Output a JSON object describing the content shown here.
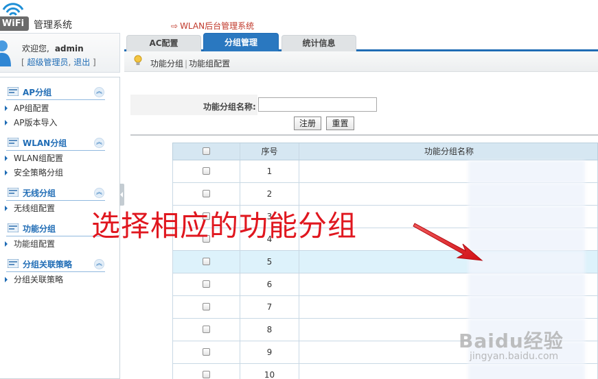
{
  "header": {
    "logo_text": "WiFi",
    "system_title": "管理系统",
    "top_link": "WLAN后台管理系统"
  },
  "user": {
    "welcome": "欢迎您,",
    "username": "admin",
    "role": "超级管理员",
    "logout": "退出",
    "bracket_open": "[",
    "bracket_sep": ",",
    "bracket_close": "]"
  },
  "sidebar": {
    "groups": [
      {
        "title": "AP分组",
        "items": [
          "AP组配置",
          "AP版本导入"
        ]
      },
      {
        "title": "WLAN分组",
        "items": [
          "WLAN组配置",
          "安全策略分组"
        ]
      },
      {
        "title": "无线分组",
        "items": [
          "无线组配置"
        ]
      },
      {
        "title": "功能分组",
        "items": [
          "功能组配置"
        ]
      },
      {
        "title": "分组关联策略",
        "items": [
          "分组关联策略"
        ]
      }
    ]
  },
  "tabs": [
    {
      "label": "AC配置",
      "active": false
    },
    {
      "label": "分组管理",
      "active": true
    },
    {
      "label": "统计信息",
      "active": false
    }
  ],
  "breadcrumb": {
    "parent": "功能分组",
    "current": "功能组配置"
  },
  "search": {
    "label": "功能分组名称:",
    "value": "",
    "submit_label": "注册",
    "reset_label": "重置"
  },
  "table": {
    "columns": {
      "select": "",
      "index": "序号",
      "name": "功能分组名称"
    },
    "rows": [
      {
        "index": "1",
        "name": "",
        "highlighted": false
      },
      {
        "index": "2",
        "name": "",
        "highlighted": false
      },
      {
        "index": "3",
        "name": "",
        "highlighted": false
      },
      {
        "index": "4",
        "name": "",
        "highlighted": false
      },
      {
        "index": "5",
        "name": "",
        "highlighted": true
      },
      {
        "index": "6",
        "name": "",
        "highlighted": false
      },
      {
        "index": "7",
        "name": "",
        "highlighted": false
      },
      {
        "index": "8",
        "name": "",
        "highlighted": false
      },
      {
        "index": "9",
        "name": "",
        "highlighted": false
      },
      {
        "index": "10",
        "name": "",
        "highlighted": false
      }
    ]
  },
  "annotation": {
    "text": "选择相应的功能分组",
    "color": "#e0171f"
  },
  "watermark": {
    "brand": "Baidu经验",
    "url": "jingyan.baidu.com"
  },
  "colors": {
    "accent": "#1f6cb5",
    "active_tab": "#2a78c0",
    "highlight_row": "#ddf2fb",
    "link": "#c0392b"
  }
}
